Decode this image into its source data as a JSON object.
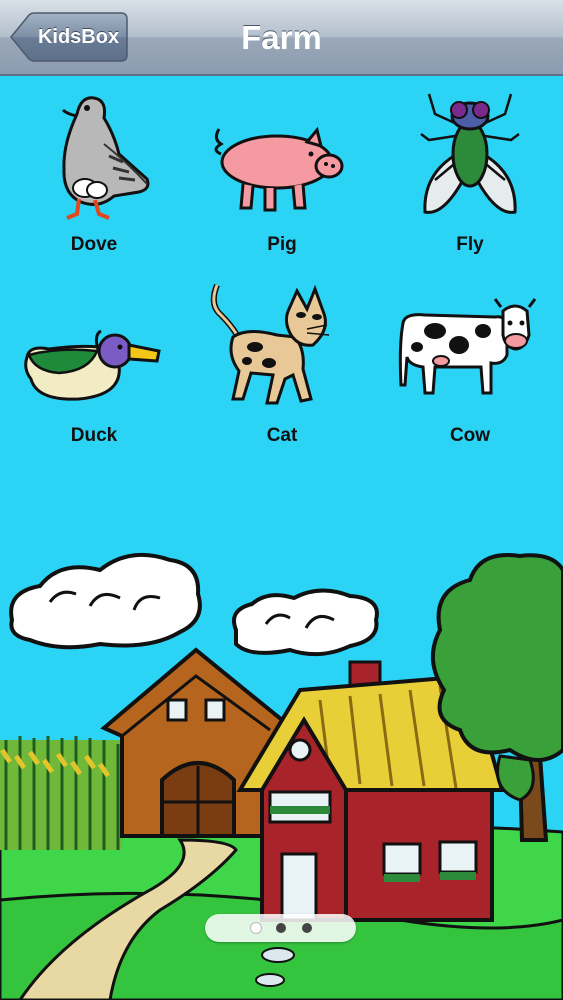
{
  "navbar": {
    "back_label": "KidsBox",
    "title": "Farm"
  },
  "animals": [
    {
      "name": "Dove",
      "icon": "dove-icon"
    },
    {
      "name": "Pig",
      "icon": "pig-icon"
    },
    {
      "name": "Fly",
      "icon": "fly-icon"
    },
    {
      "name": "Duck",
      "icon": "duck-icon"
    },
    {
      "name": "Cat",
      "icon": "cat-icon"
    },
    {
      "name": "Cow",
      "icon": "cow-icon"
    }
  ],
  "pager": {
    "page_count": 3,
    "current_page": 1
  },
  "colors": {
    "sky": "#2bd3f5",
    "grass": "#3fd64a",
    "barn_red": "#a8232a"
  }
}
